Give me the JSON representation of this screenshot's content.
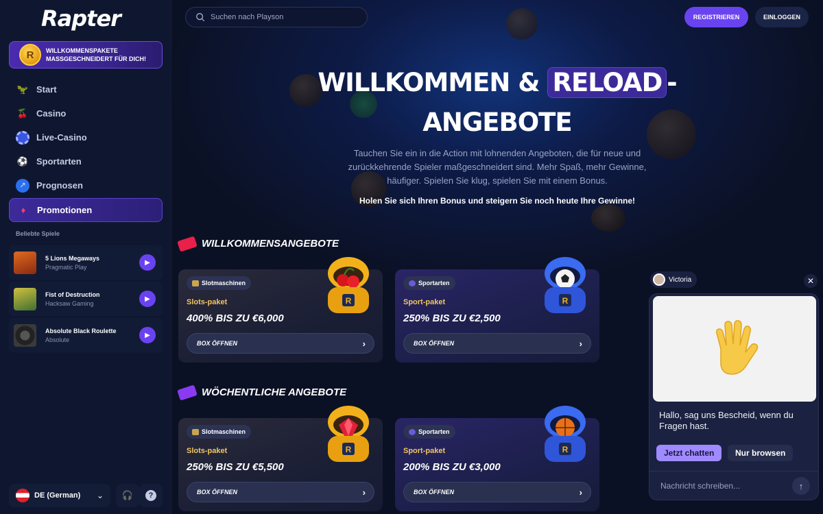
{
  "brand": {
    "logo": "Rapter",
    "accent": "#6a43f0",
    "gold": "#f1c663"
  },
  "sidebar": {
    "welcome_pack": {
      "line1": "WILLKOMMENSPAKETE",
      "line2": "MASSGESCHNEIDERT FÜR DICH!"
    },
    "nav": [
      {
        "label": "Start",
        "icon": "dino-icon"
      },
      {
        "label": "Casino",
        "icon": "cherry-icon"
      },
      {
        "label": "Live-Casino",
        "icon": "chip-icon"
      },
      {
        "label": "Sportarten",
        "icon": "soccer-ball-icon"
      },
      {
        "label": "Prognosen",
        "icon": "chart-icon"
      },
      {
        "label": "Promotionen",
        "icon": "gem-icon",
        "active": true
      }
    ],
    "popular_title": "Beliebte Spiele",
    "games": [
      {
        "title": "5 Lions Megaways",
        "provider": "Pragmatic Play"
      },
      {
        "title": "Fist of Destruction",
        "provider": "Hacksaw Gaming"
      },
      {
        "title": "Absolute Black Roulette",
        "provider": "Absolute"
      }
    ],
    "language": "DE (German)"
  },
  "header": {
    "search_placeholder": "Suchen nach Playson",
    "register": "REGISTRIEREN",
    "login": "EINLOGGEN"
  },
  "hero": {
    "title_part1": "WILLKOMMEN &",
    "title_highlight": "RELOAD",
    "title_part2": "-",
    "title_line2": "ANGEBOTE",
    "description": "Tauchen Sie ein in die Action mit lohnenden Angeboten, die für neue und zurückkehrende Spieler maßgeschneidert sind. Mehr Spaß, mehr Gewinne, häufiger. Spielen Sie klug, spielen Sie mit einem Bonus.",
    "cta": "Holen Sie sich Ihren Bonus und steigern Sie noch heute Ihre Gewinne!"
  },
  "sections": [
    {
      "title": "WILLKOMMENSANGEBOTE",
      "cards": [
        {
          "tag": "Slotmaschinen",
          "label": "Slots-paket",
          "amount": "400% BIS ZU €6,000",
          "button": "BOX ÖFFNEN"
        },
        {
          "tag": "Sportarten",
          "label": "Sport-paket",
          "amount": "250% BIS ZU €2,500",
          "button": "BOX ÖFFNEN"
        }
      ]
    },
    {
      "title": "WÖCHENTLICHE ANGEBOTE",
      "cards": [
        {
          "tag": "Slotmaschinen",
          "label": "Slots-paket",
          "amount": "250% BIS ZU €5,500",
          "button": "BOX ÖFFNEN"
        },
        {
          "tag": "Sportarten",
          "label": "Sport-paket",
          "amount": "200% BIS ZU €3,000",
          "button": "BOX ÖFFNEN"
        }
      ]
    }
  ],
  "chat": {
    "agent": "Victoria",
    "message": "Hallo, sag uns Bescheid, wenn du Fragen hast.",
    "btn_chat": "Jetzt chatten",
    "btn_browse": "Nur browsen",
    "input_placeholder": "Nachricht schreiben..."
  }
}
